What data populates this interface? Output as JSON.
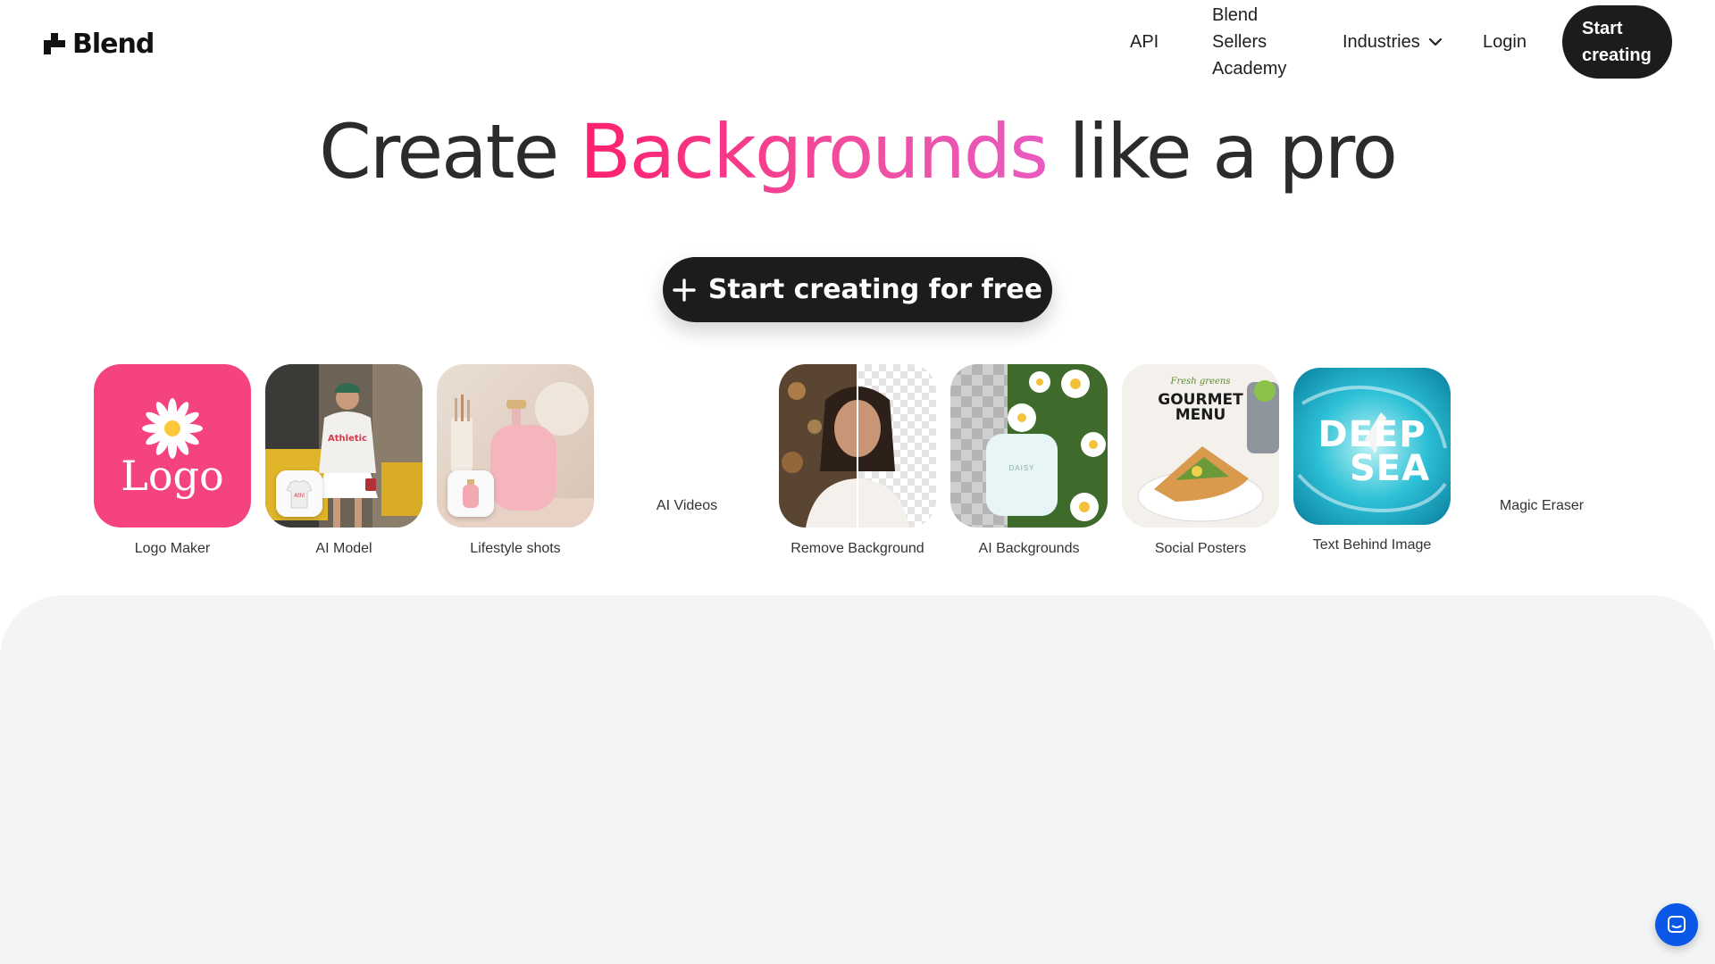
{
  "brand": {
    "name": "Blend",
    "logo_icon": "blend-logo-mark"
  },
  "nav": {
    "api": "API",
    "academy": "Blend Sellers Academy",
    "industries": "Industries",
    "industries_icon": "chevron-down-icon",
    "login": "Login",
    "start_button": "Start creating"
  },
  "hero": {
    "title_before": "Create ",
    "title_accent": "Backgrounds",
    "title_after": " like a pro",
    "cta_label": "Start creating for free",
    "cta_icon": "plus-icon"
  },
  "tools": [
    {
      "label": "Logo Maker",
      "thumb_text": "Logo"
    },
    {
      "label": "AI Model"
    },
    {
      "label": "Lifestyle shots"
    },
    {
      "label": "AI Videos"
    },
    {
      "label": "Remove Background"
    },
    {
      "label": "AI Backgrounds",
      "thumb_text": "DAISY"
    },
    {
      "label": "Social Posters",
      "thumb_text_1": "Fresh greens",
      "thumb_text_2": "GOURMET",
      "thumb_text_3": "MENU"
    },
    {
      "label": "Text Behind Image",
      "thumb_text_1": "DEEP",
      "thumb_text_2": "SEA"
    },
    {
      "label": "Magic Eraser"
    }
  ],
  "colors": {
    "accent_pink": "#ff1f6e",
    "dark_button": "#1c1c1c",
    "panel_bg": "#f3f4f6",
    "chat_blue": "#0a57e8"
  },
  "chat": {
    "icon": "chat-icon"
  }
}
